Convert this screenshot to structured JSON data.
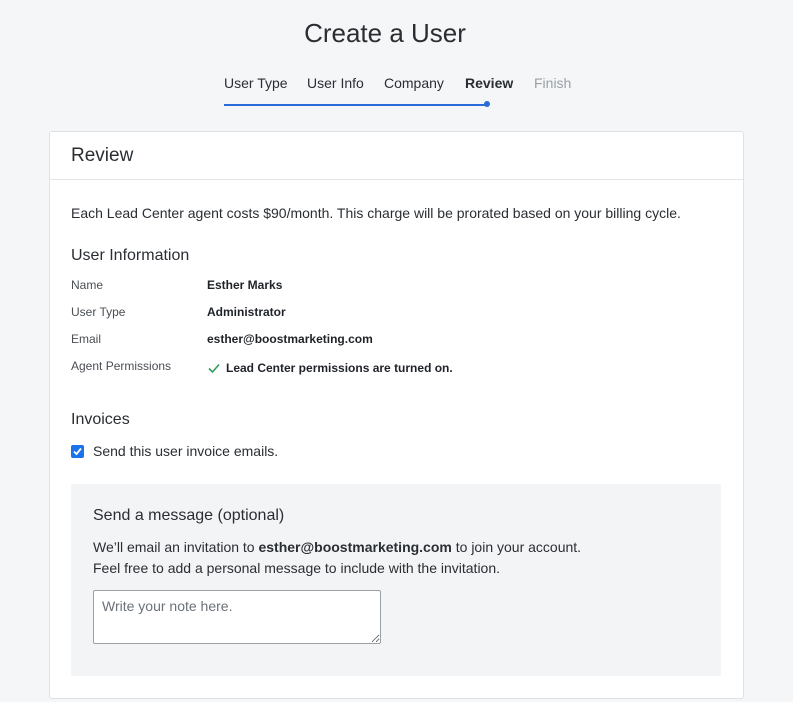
{
  "page": {
    "title": "Create a User"
  },
  "stepper": {
    "steps": [
      {
        "label": "User Type",
        "state": "complete"
      },
      {
        "label": "User Info",
        "state": "complete"
      },
      {
        "label": "Company",
        "state": "complete"
      },
      {
        "label": "Review",
        "state": "active"
      },
      {
        "label": "Finish",
        "state": "disabled"
      }
    ],
    "accent_color": "#2a6bd8"
  },
  "review": {
    "title": "Review",
    "notice": "Each Lead Center agent costs $90/month. This charge will be prorated based on your billing cycle.",
    "user_information": {
      "title": "User Information",
      "fields": [
        {
          "label": "Name",
          "value": "Esther Marks"
        },
        {
          "label": "User Type",
          "value": "Administrator"
        },
        {
          "label": "Email",
          "value": "esther@boostmarketing.com"
        },
        {
          "label": "Agent Permissions",
          "value": "Lead Center permissions are turned on.",
          "icon": "check-icon",
          "icon_color": "#2e9e5b"
        }
      ]
    },
    "invoices": {
      "title": "Invoices",
      "checkbox_label": "Send this user invoice emails.",
      "checked": true
    },
    "message": {
      "title": "Send a message (optional)",
      "line1_prefix": "We’ll email an invitation to ",
      "line1_email": "esther@boostmarketing.com",
      "line1_suffix": " to join your account.",
      "line2": "Feel free to add a personal message to include with the invitation.",
      "note_placeholder": "Write your note here.",
      "note_value": ""
    }
  }
}
